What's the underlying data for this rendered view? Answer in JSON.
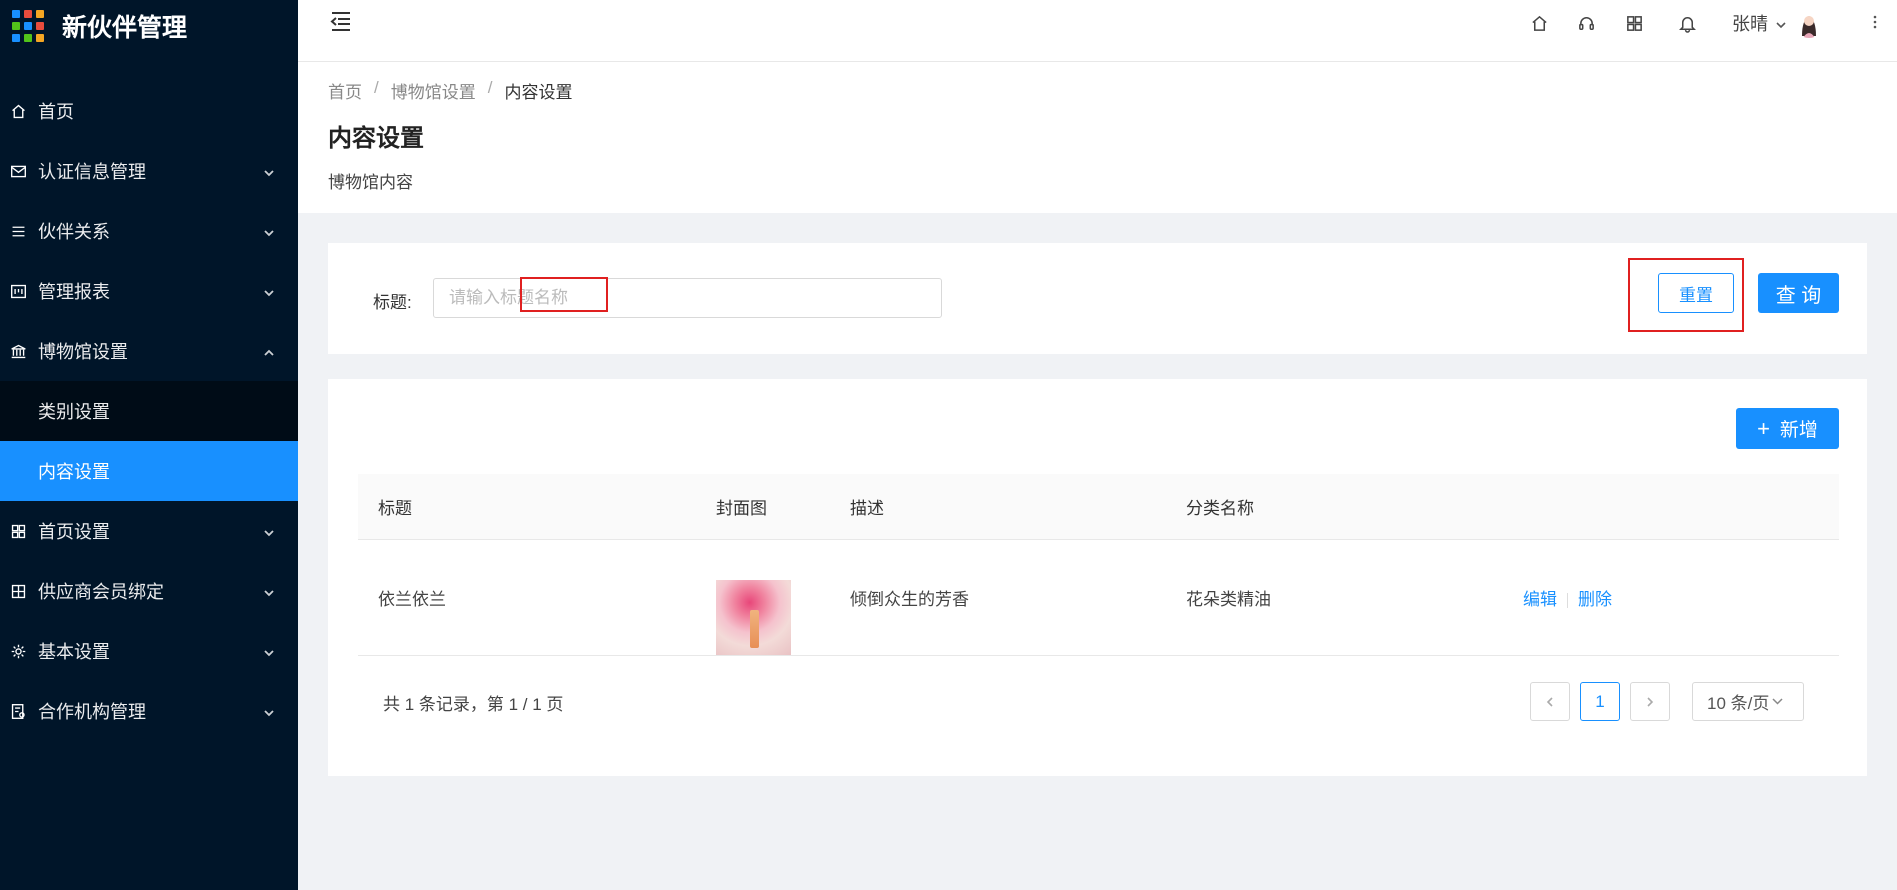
{
  "app": {
    "title": "新伙伴管理",
    "logo_colors": [
      "#1890ff",
      "#e84c3d",
      "#f5a623",
      "#52c41a",
      "#1890ff",
      "#e84c3d",
      "#1890ff",
      "#52c41a",
      "#f5a623"
    ]
  },
  "sidebar": {
    "items": [
      {
        "label": "首页",
        "icon": "home-icon",
        "has_arrow": false
      },
      {
        "label": "认证信息管理",
        "icon": "mail-icon",
        "has_arrow": true
      },
      {
        "label": "伙伴关系",
        "icon": "list-icon",
        "has_arrow": true
      },
      {
        "label": "管理报表",
        "icon": "report-icon",
        "has_arrow": true
      },
      {
        "label": "博物馆设置",
        "icon": "bank-icon",
        "has_arrow": true,
        "expanded": true
      },
      {
        "label": "首页设置",
        "icon": "layout-icon",
        "has_arrow": true
      },
      {
        "label": "供应商会员绑定",
        "icon": "table-icon",
        "has_arrow": true
      },
      {
        "label": "基本设置",
        "icon": "gear-icon",
        "has_arrow": true
      },
      {
        "label": "合作机构管理",
        "icon": "audit-icon",
        "has_arrow": true
      }
    ],
    "submenu": [
      {
        "label": "类别设置",
        "active": false
      },
      {
        "label": "内容设置",
        "active": true
      }
    ]
  },
  "header": {
    "user_name": "张晴"
  },
  "breadcrumb": [
    "首页",
    "博物馆设置",
    "内容设置"
  ],
  "page": {
    "title": "内容设置",
    "description": "博物馆内容"
  },
  "search": {
    "label": "标题:",
    "placeholder": "请输入标题名称",
    "value": "",
    "reset_label": "重置",
    "query_label": "查 询"
  },
  "table": {
    "add_label": "新增",
    "columns": [
      "标题",
      "封面图",
      "描述",
      "分类名称",
      ""
    ],
    "rows": [
      {
        "title": "依兰依兰",
        "cover": "cover-image",
        "description": "倾倒众生的芳香",
        "category": "花朵类精油",
        "edit": "编辑",
        "delete": "删除"
      }
    ]
  },
  "pagination": {
    "summary": "共 1 条记录，第 1 / 1 页",
    "current_page": "1",
    "page_size": "10 条/页"
  },
  "colors": {
    "sidebar_bg": "#001529",
    "primary": "#1890ff",
    "annotation_red": "#e02020"
  }
}
